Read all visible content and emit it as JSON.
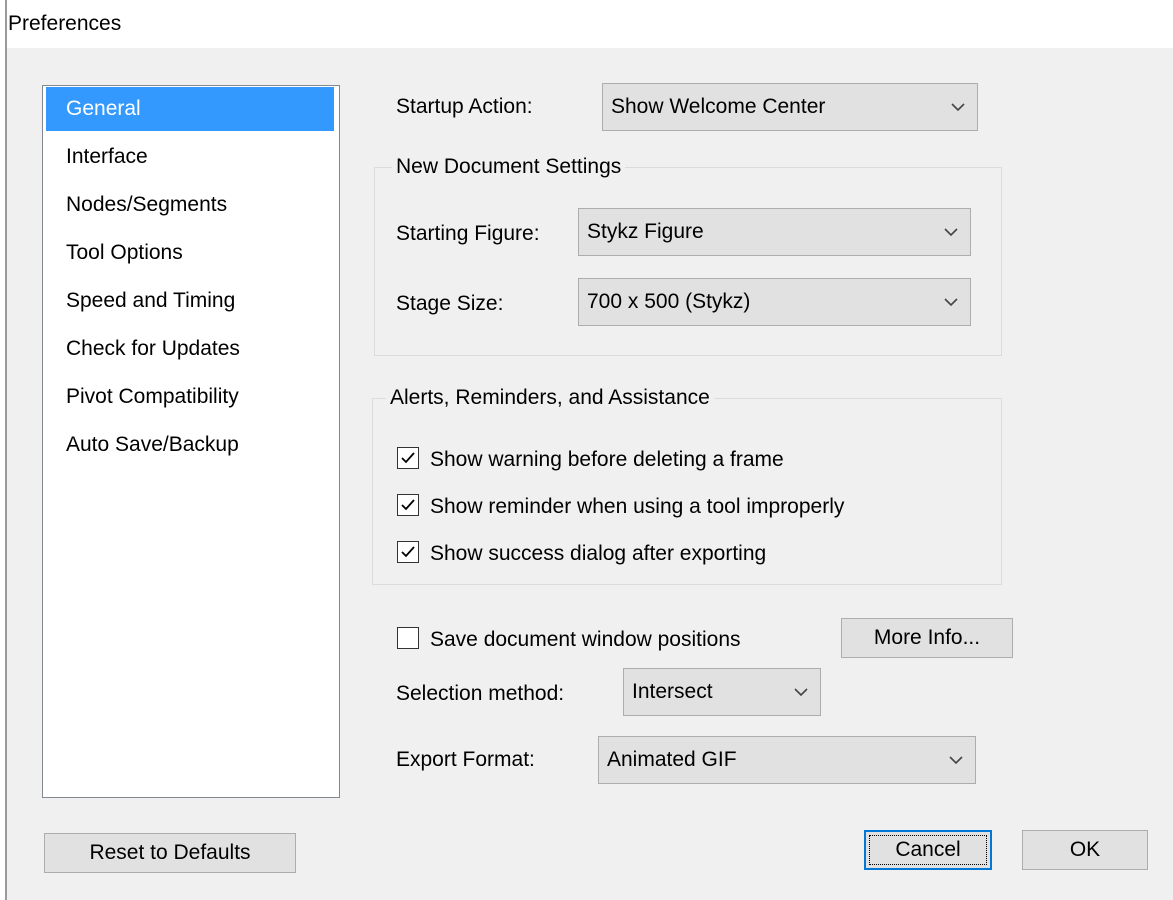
{
  "window": {
    "title": "Preferences"
  },
  "categories": [
    {
      "label": "General",
      "selected": true
    },
    {
      "label": "Interface",
      "selected": false
    },
    {
      "label": "Nodes/Segments",
      "selected": false
    },
    {
      "label": "Tool Options",
      "selected": false
    },
    {
      "label": "Speed and Timing",
      "selected": false
    },
    {
      "label": "Check for Updates",
      "selected": false
    },
    {
      "label": "Pivot Compatibility",
      "selected": false
    },
    {
      "label": "Auto Save/Backup",
      "selected": false
    }
  ],
  "startup": {
    "label": "Startup Action:",
    "value": "Show Welcome Center"
  },
  "new_doc": {
    "caption": "New Document Settings",
    "starting_figure": {
      "label": "Starting Figure:",
      "value": "Stykz Figure"
    },
    "stage_size": {
      "label": "Stage Size:",
      "value": "700 x 500 (Stykz)"
    }
  },
  "alerts": {
    "caption": "Alerts, Reminders, and Assistance",
    "items": [
      {
        "label": "Show warning before deleting a frame",
        "checked": true
      },
      {
        "label": "Show reminder when using a tool improperly",
        "checked": true
      },
      {
        "label": "Show success dialog after exporting",
        "checked": true
      }
    ]
  },
  "save_positions": {
    "label": "Save document window positions",
    "checked": false
  },
  "more_info_label": "More Info...",
  "selection_method": {
    "label": "Selection method:",
    "value": "Intersect"
  },
  "export_format": {
    "label": "Export Format:",
    "value": "Animated GIF"
  },
  "buttons": {
    "reset": "Reset to Defaults",
    "cancel": "Cancel",
    "ok": "OK"
  },
  "colors": {
    "selection": "#3399ff",
    "dialog_bg": "#f0f0f0",
    "focus_border": "#0078d7"
  }
}
